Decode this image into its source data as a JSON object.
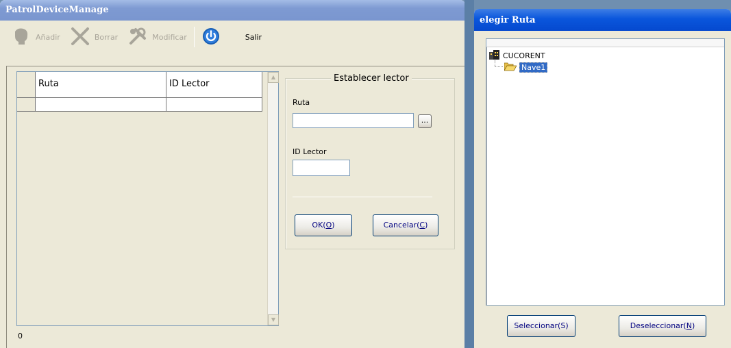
{
  "left_window": {
    "title": "PatrolDeviceManage",
    "toolbar": {
      "add_label": "Añadir",
      "delete_label": "Borrar",
      "modify_label": "Modificar",
      "exit_label": "Salir"
    },
    "grid": {
      "columns": [
        "Ruta",
        "ID Lector"
      ],
      "rows": [
        [
          "",
          ""
        ]
      ]
    },
    "group": {
      "title": "Establecer lector",
      "route_label": "Ruta",
      "route_value": "",
      "browse_label": "...",
      "reader_label": "ID Lector",
      "reader_value": "",
      "ok_text": "OK(",
      "ok_key": "O",
      "ok_end": ")",
      "cancel_text": "Cancelar(",
      "cancel_key": "C",
      "cancel_end": ")"
    },
    "status_count": "0"
  },
  "right_window": {
    "title": "elegir Ruta",
    "tree": {
      "root": "CUCORENT",
      "child": "Nave1"
    },
    "select_label": "Seleccionar(S)",
    "deselect_text": "Deseleccionar(",
    "deselect_key": "N",
    "deselect_end": ")"
  },
  "colors": {
    "active_title": "#0a56dc",
    "inactive_title": "#7e9ad2",
    "window_bg": "#ece9d8",
    "selection": "#316ac5"
  }
}
